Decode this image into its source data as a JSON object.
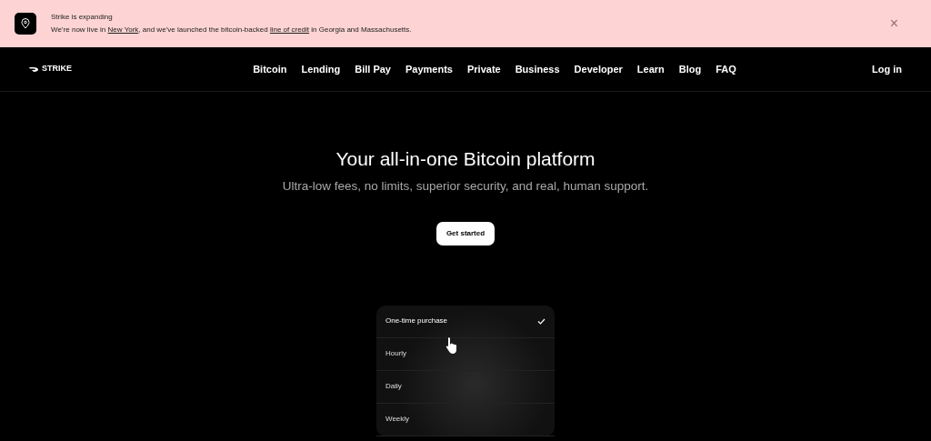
{
  "banner": {
    "title": "Strike is expanding",
    "message": "We’re now live in **New York**, and we’ve launched the bitcoin-backed **line of credit** in Georgia and Massachusetts.",
    "close": "×"
  },
  "navbar": {
    "brand": "STRIKE",
    "links": [
      "Bitcoin",
      "Lending",
      "Bill Pay",
      "Payments",
      "Private",
      "Business",
      "Developer",
      "Learn",
      "Blog",
      "FAQ"
    ],
    "login": "Log in"
  },
  "hero": {
    "title": "Your all-in-one Bitcoin platform",
    "subtitle": "Ultra-low fees, no limits, superior security, and real, human support.",
    "button": "Get started"
  },
  "options": [
    {
      "label": "One-time purchase",
      "selected": true
    },
    {
      "label": "Hourly",
      "selected": false
    },
    {
      "label": "Daily",
      "selected": false
    },
    {
      "label": "Weekly",
      "selected": false
    }
  ]
}
